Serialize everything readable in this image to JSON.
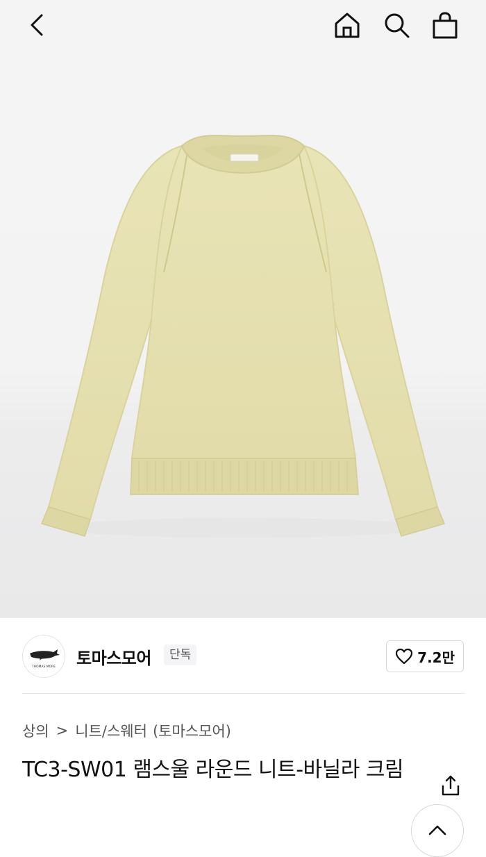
{
  "brand": {
    "name": "토마스모어",
    "badge": "단독",
    "logo_text": "THOMAS MORE"
  },
  "like": {
    "count": "7.2만"
  },
  "breadcrumb": {
    "category": "상의",
    "separator": ">",
    "subcategory": "니트/스웨터",
    "brand_note": "(토마스모어)"
  },
  "product": {
    "title": "TC3-SW01 램스울 라운드 니트-바닐라 크림",
    "image_subject": "vanilla cream round-neck lambswool knit sweater"
  },
  "icons": {
    "back": "chevron-left-icon",
    "home": "home-icon",
    "search": "search-icon",
    "cart": "shopping-bag-icon",
    "heart": "heart-icon",
    "share": "share-icon",
    "scroll_top": "chevron-up-icon"
  },
  "colors": {
    "sweater": "#e7e2b2",
    "background": "#f3f3f3",
    "text": "#111111"
  }
}
